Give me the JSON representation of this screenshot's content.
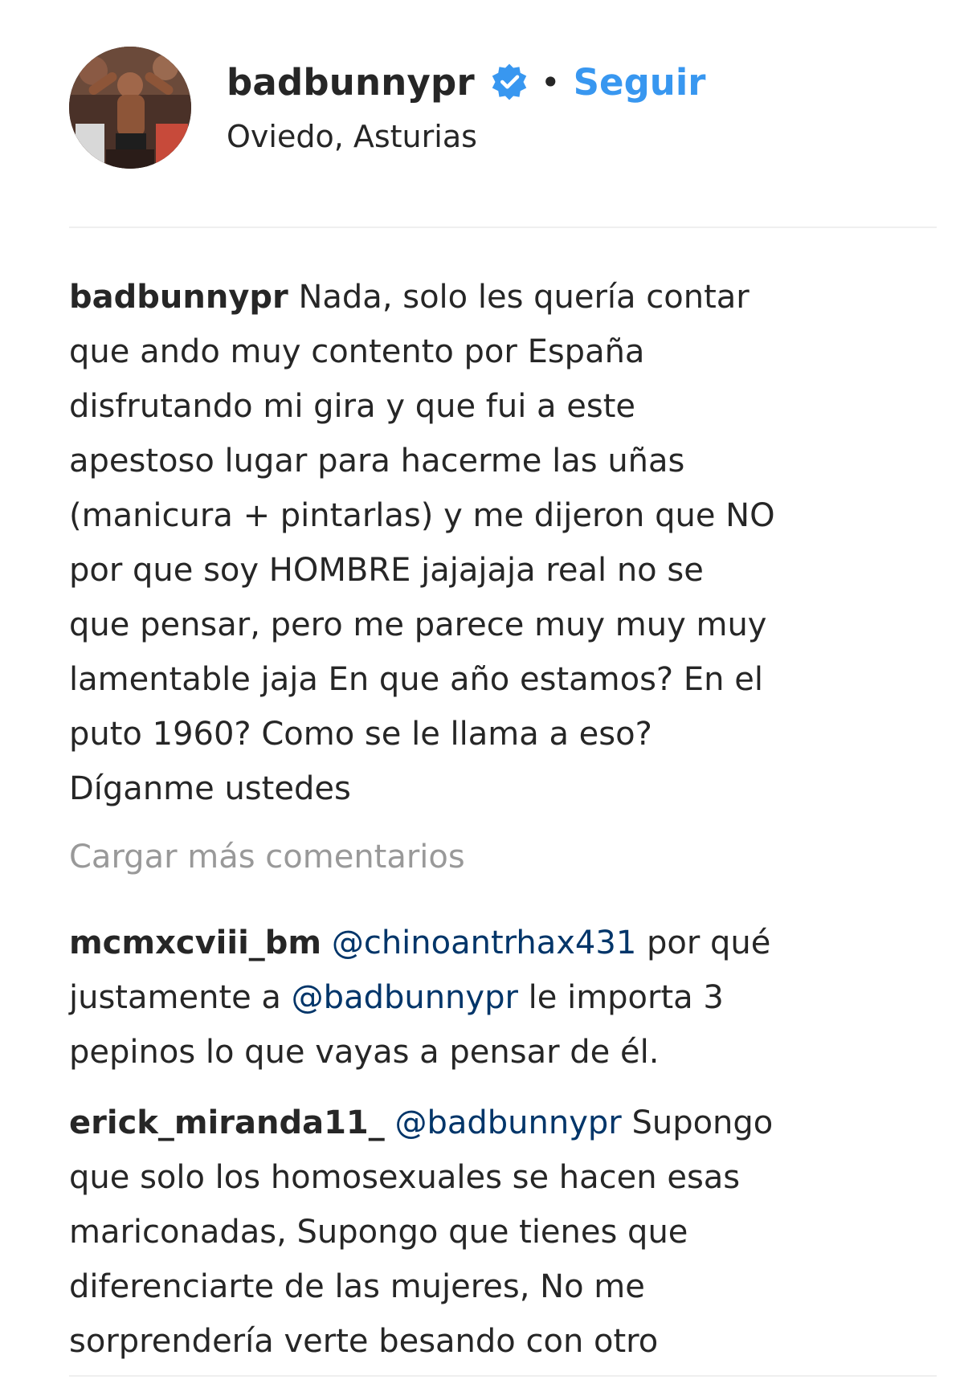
{
  "header": {
    "username": "badbunnypr",
    "verified_icon": "verified-badge-icon",
    "separator": "•",
    "follow_label": "Seguir",
    "location": "Oviedo, Asturias"
  },
  "caption": {
    "username": "badbunnypr",
    "lines": [
      " Nada, solo les quería contar",
      "que ando muy contento por España",
      "disfrutando mi gira y que fui a este",
      "apestoso lugar para hacerme las uñas",
      "(manicura + pintarlas) y me dijeron que NO",
      "por que soy HOMBRE jajajaja real no se",
      "que pensar, pero me parece muy muy muy",
      "lamentable jaja En que año estamos? En el",
      "puto 1960? Como se le llama a eso?",
      "Díganme ustedes"
    ]
  },
  "load_more_label": "Cargar más comentarios",
  "comments": [
    {
      "username": "mcmxcviii_bm",
      "mention": "@chinoantrhax431",
      "line1_rest": " por qué",
      "line2_prefix": "justamente a ",
      "line2_mention": "@badbunnypr",
      "line2_rest": " le importa 3",
      "line3": "pepinos lo que vayas a pensar de él."
    },
    {
      "username": "erick_miranda11_",
      "mention": "@badbunnypr",
      "line1_rest": " Supongo",
      "lines": [
        "que solo los homosexuales se hacen esas",
        "mariconadas, Supongo que tienes que",
        "diferenciarte de las mujeres, No me",
        "sorprendería verte besando con otro"
      ]
    }
  ],
  "colors": {
    "text": "#262626",
    "link_blue": "#3897f0",
    "mention": "#003569",
    "muted": "#999999",
    "divider": "#efefef"
  }
}
